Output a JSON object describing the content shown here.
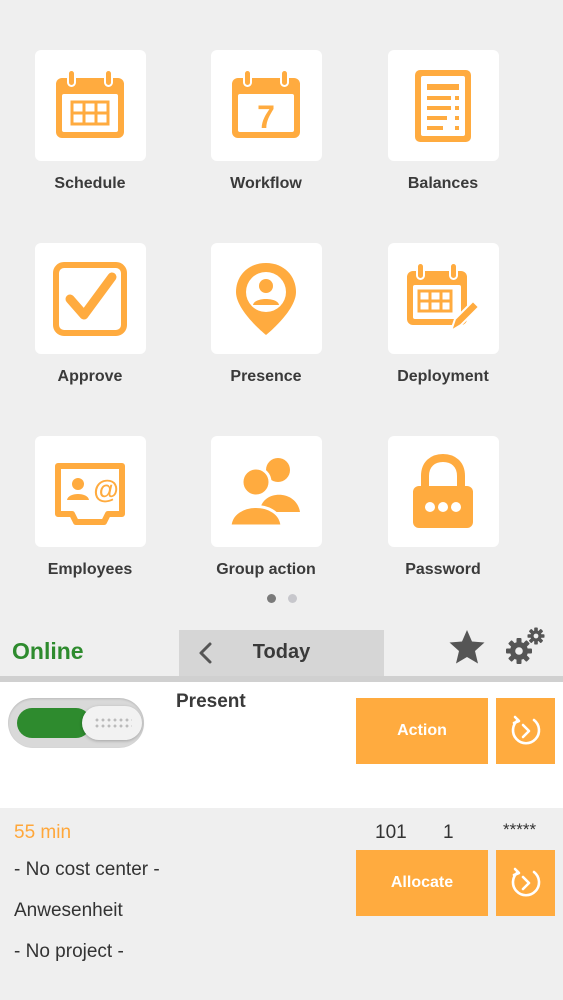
{
  "tiles": [
    {
      "label": "Schedule",
      "icon": "calendar-grid-icon"
    },
    {
      "label": "Workflow",
      "icon": "calendar-day-icon",
      "day": "7"
    },
    {
      "label": "Balances",
      "icon": "document-list-icon"
    },
    {
      "label": "Approve",
      "icon": "checkbox-icon"
    },
    {
      "label": "Presence",
      "icon": "location-pin-person-icon"
    },
    {
      "label": "Deployment",
      "icon": "calendar-pencil-icon"
    },
    {
      "label": "Employees",
      "icon": "contact-card-icon"
    },
    {
      "label": "Group action",
      "icon": "group-people-icon"
    },
    {
      "label": "Password",
      "icon": "padlock-icon"
    }
  ],
  "pager": {
    "pages": 2,
    "current": 1
  },
  "status": {
    "connection": "Online",
    "day_label": "Today"
  },
  "presence": {
    "state_label": "Present",
    "switch_on": true,
    "action_label": "Action"
  },
  "booking": {
    "duration": "55 min",
    "cost_center": "- No cost center -",
    "activity": "Anwesenheit",
    "project": "- No project -",
    "code1": "101",
    "code2": "1",
    "masked": "*****",
    "allocate_label": "Allocate"
  },
  "colors": {
    "accent": "#ffab3f",
    "online": "#2e8b2e",
    "background": "#efefef"
  }
}
